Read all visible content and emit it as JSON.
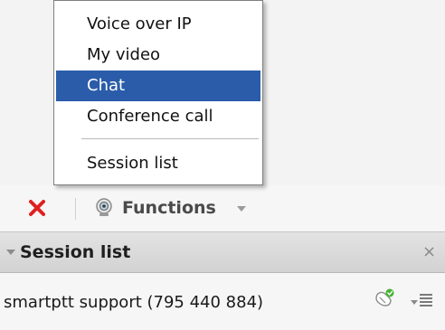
{
  "menu": {
    "items": [
      {
        "label": "Voice over IP"
      },
      {
        "label": "My video"
      },
      {
        "label": "Chat",
        "selected": true
      },
      {
        "label": "Conference call"
      },
      {
        "label": "Session list"
      }
    ]
  },
  "toolbar": {
    "close_icon": "close-x-icon",
    "functions_icon": "webcam-icon",
    "functions_label": "Functions"
  },
  "session_list": {
    "title": "Session list",
    "close_glyph": "×",
    "items": [
      {
        "name": "smartptt support (795 440 884)",
        "status_icon": "phone-online-icon"
      }
    ]
  },
  "colors": {
    "selection": "#2a5caa",
    "close_red": "#e02020",
    "online_green": "#45b233"
  }
}
